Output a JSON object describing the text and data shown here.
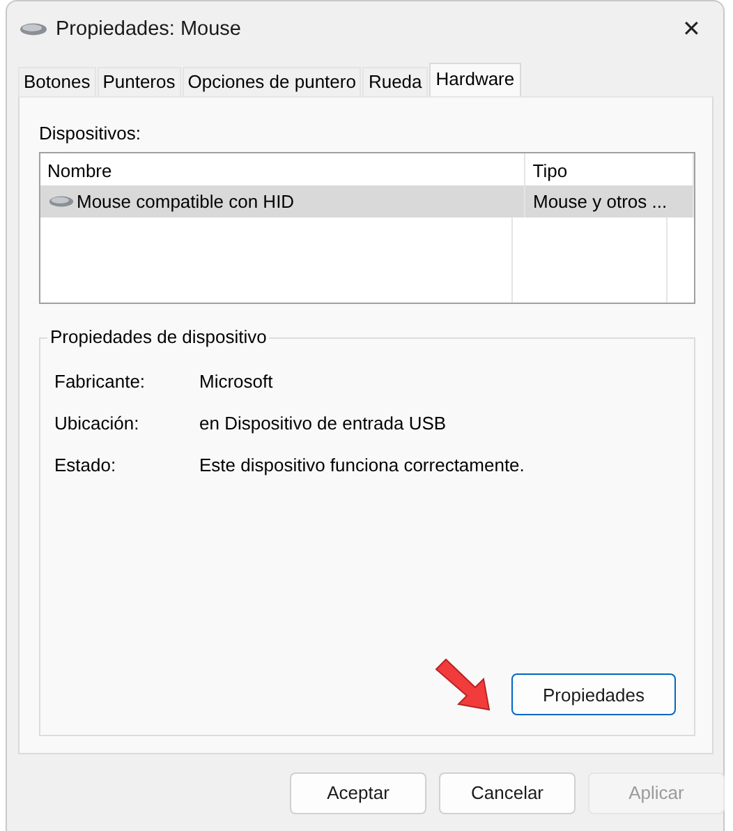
{
  "window": {
    "title": "Propiedades: Mouse",
    "close": "✕"
  },
  "tabs": [
    {
      "label": "Botones",
      "selected": false
    },
    {
      "label": "Punteros",
      "selected": false
    },
    {
      "label": "Opciones de puntero",
      "selected": false
    },
    {
      "label": "Rueda",
      "selected": false
    },
    {
      "label": "Hardware",
      "selected": true
    }
  ],
  "devices": {
    "label": "Dispositivos:",
    "columns": [
      "Nombre",
      "Tipo"
    ],
    "rows": [
      {
        "name": "Mouse compatible con HID",
        "type": "Mouse y otros ...",
        "selected": true
      }
    ]
  },
  "device_properties": {
    "title": "Propiedades de dispositivo",
    "fields": [
      {
        "label": "Fabricante:",
        "value": "Microsoft"
      },
      {
        "label": "Ubicación:",
        "value": "en Dispositivo de entrada USB"
      },
      {
        "label": "Estado:",
        "value": "Este dispositivo funciona correctamente."
      }
    ],
    "button": "Propiedades"
  },
  "buttons": [
    {
      "label": "Aceptar",
      "disabled": false
    },
    {
      "label": "Cancelar",
      "disabled": false
    },
    {
      "label": "Aplicar",
      "disabled": true
    }
  ]
}
